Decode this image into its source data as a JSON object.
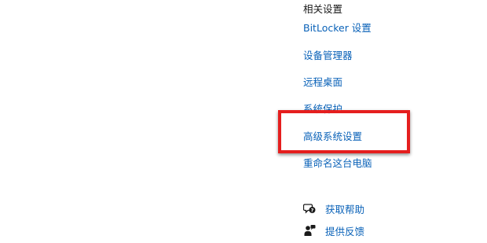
{
  "related_settings": {
    "title": "相关设置",
    "links": [
      "BitLocker 设置",
      "设备管理器",
      "远程桌面",
      "系统保护",
      "高级系统设置",
      "重命名这台电脑"
    ]
  },
  "help": {
    "get_help_label": "获取帮助",
    "get_help_icon": "chat-help-icon",
    "feedback_label": "提供反馈",
    "feedback_icon": "feedback-person-icon"
  },
  "colors": {
    "link": "#0a62b8",
    "highlight": "#e51e1e"
  }
}
